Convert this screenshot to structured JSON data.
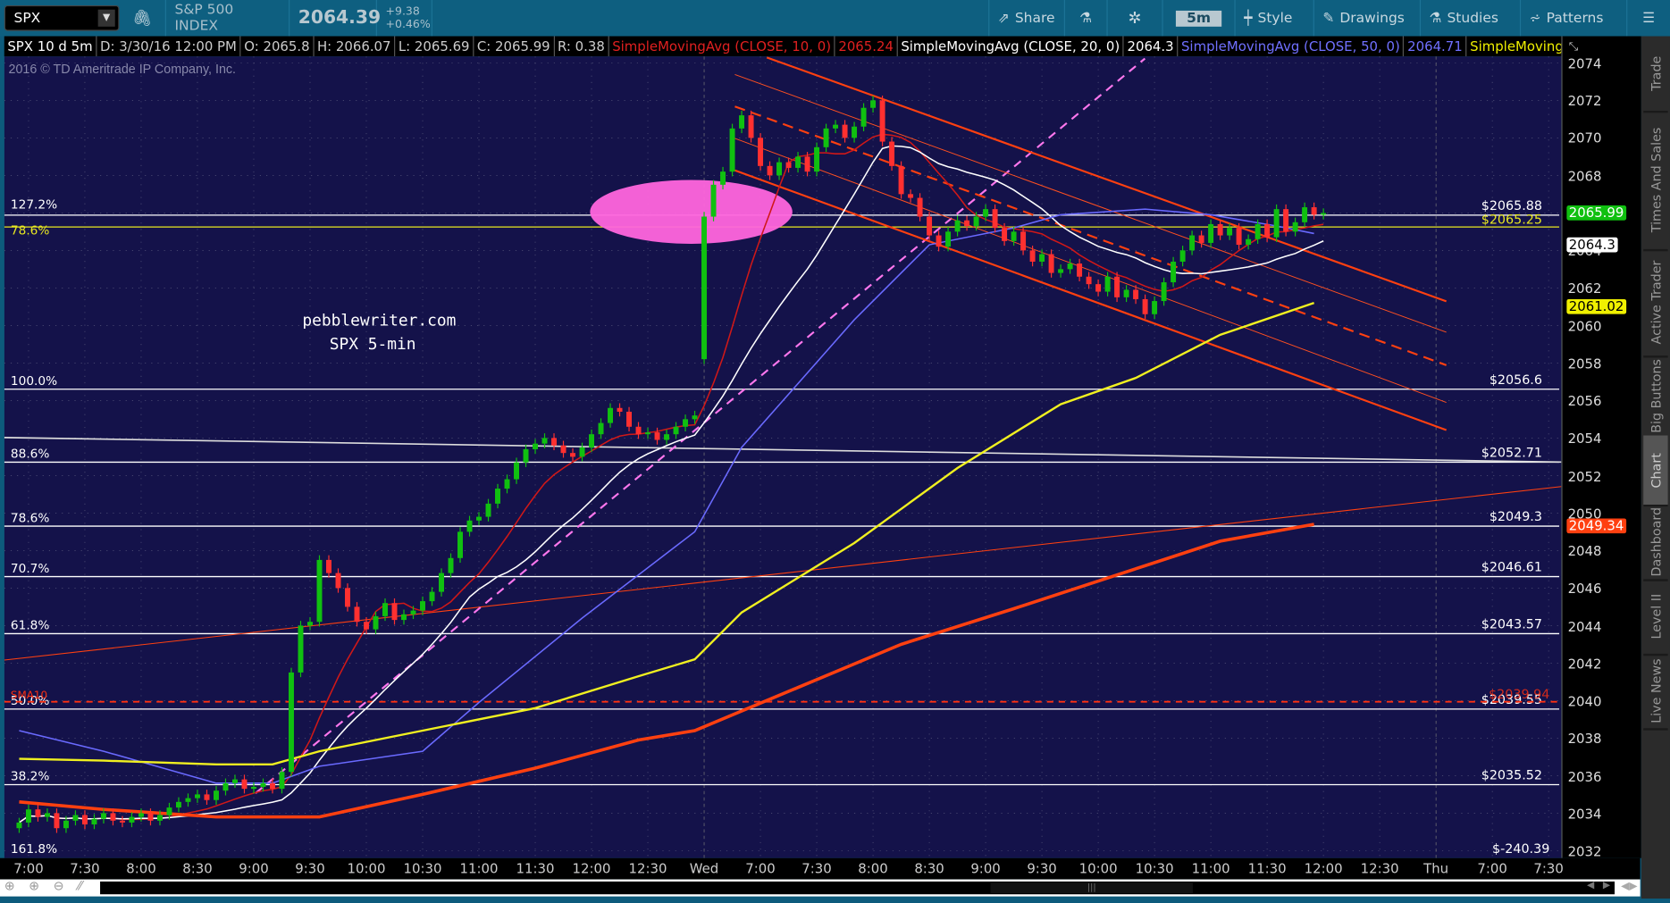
{
  "toolbar": {
    "symbol": "SPX",
    "description": "S&P 500 INDEX",
    "last": "2064.39",
    "change": "+9.38",
    "change_pct": "+0.46%",
    "share": "Share",
    "interval": "5m",
    "style": "Style",
    "drawings": "Drawings",
    "studies": "Studies",
    "patterns": "Patterns"
  },
  "info": {
    "title": "SPX 10 d 5m",
    "date": "D: 3/30/16 12:00 PM",
    "open": "O: 2065.8",
    "high": "H: 2066.07",
    "low": "L: 2065.69",
    "close": "C: 2065.99",
    "range": "R: 0.38",
    "studies": [
      {
        "name": "SimpleMovingAvg (CLOSE, 10, 0)",
        "value": "2065.24",
        "color": "#e02020"
      },
      {
        "name": "SimpleMovingAvg (CLOSE, 20, 0)",
        "value": "2064.3",
        "color": "#ffffff"
      },
      {
        "name": "SimpleMovingAvg (CLOSE, 50, 0)",
        "value": "2064.71",
        "color": "#7070ff"
      },
      {
        "name": "SimpleMovingAvg ...",
        "value": "",
        "color": "#f0f000"
      }
    ]
  },
  "copyright": "2016 © TD Ameritrade IP Company, Inc.",
  "watermark": {
    "line1": "pebblewriter.com",
    "line2": "SPX 5-min"
  },
  "side_tabs": [
    "Trade",
    "Times And Sales",
    "Active Trader",
    "Big Buttons",
    "Chart",
    "Dashboard",
    "Level II",
    "Live News"
  ],
  "active_tab": "Chart",
  "chart_data": {
    "type": "candlestick",
    "ylim": [
      2032,
      2074
    ],
    "y_ticks": [
      2032,
      2034,
      2036,
      2038,
      2040,
      2042,
      2044,
      2046,
      2048,
      2050,
      2052,
      2054,
      2056,
      2058,
      2060,
      2062,
      2064,
      2066,
      2068,
      2070,
      2072,
      2074
    ],
    "x_ticks": [
      {
        "i": 1,
        "t": "7:00"
      },
      {
        "i": 7,
        "t": "7:30"
      },
      {
        "i": 13,
        "t": "8:00"
      },
      {
        "i": 19,
        "t": "8:30"
      },
      {
        "i": 25,
        "t": "9:00"
      },
      {
        "i": 31,
        "t": "9:30"
      },
      {
        "i": 37,
        "t": "10:00"
      },
      {
        "i": 43,
        "t": "10:30"
      },
      {
        "i": 49,
        "t": "11:00"
      },
      {
        "i": 55,
        "t": "11:30"
      },
      {
        "i": 61,
        "t": "12:00"
      },
      {
        "i": 67,
        "t": "12:30"
      },
      {
        "i": 73,
        "t": "Wed"
      },
      {
        "i": 79,
        "t": "7:00"
      },
      {
        "i": 85,
        "t": "7:30"
      },
      {
        "i": 91,
        "t": "8:00"
      },
      {
        "i": 97,
        "t": "8:30"
      },
      {
        "i": 103,
        "t": "9:00"
      },
      {
        "i": 109,
        "t": "9:30"
      },
      {
        "i": 115,
        "t": "10:00"
      },
      {
        "i": 121,
        "t": "10:30"
      },
      {
        "i": 127,
        "t": "11:00"
      },
      {
        "i": 133,
        "t": "11:30"
      },
      {
        "i": 139,
        "t": "12:00"
      },
      {
        "i": 145,
        "t": "12:30"
      },
      {
        "i": 151,
        "t": "Thu"
      },
      {
        "i": 157,
        "t": "7:00"
      },
      {
        "i": 163,
        "t": "7:30"
      }
    ],
    "sessions": [
      {
        "start": 0,
        "open": 2033.2
      },
      {
        "start": 73,
        "open": 2058.2
      }
    ],
    "closes": [
      2033.5,
      2034.2,
      2033.8,
      2034.0,
      2033.2,
      2033.6,
      2033.9,
      2033.4,
      2033.7,
      2034.0,
      2033.6,
      2033.5,
      2033.8,
      2034.0,
      2033.6,
      2033.9,
      2034.3,
      2034.6,
      2034.8,
      2035.0,
      2034.7,
      2035.2,
      2035.6,
      2035.8,
      2035.3,
      2035.4,
      2035.6,
      2035.3,
      2036.2,
      2041.5,
      2044.0,
      2044.2,
      2047.5,
      2046.8,
      2046.0,
      2045.0,
      2044.2,
      2043.8,
      2044.5,
      2045.2,
      2044.3,
      2044.6,
      2044.8,
      2045.3,
      2045.8,
      2046.8,
      2047.6,
      2049.0,
      2049.6,
      2049.8,
      2050.5,
      2051.3,
      2051.8,
      2052.7,
      2053.4,
      2053.7,
      2054.0,
      2053.6,
      2053.2,
      2053.0,
      2053.5,
      2054.2,
      2054.8,
      2055.6,
      2055.4,
      2054.6,
      2054.2,
      2054.3,
      2053.9,
      2054.2,
      2054.6,
      2055.0,
      2055.2,
      2065.8,
      2067.5,
      2068.2,
      2070.5,
      2071.2,
      2070.0,
      2068.5,
      2068.0,
      2068.7,
      2068.4,
      2069.0,
      2068.2,
      2069.5,
      2070.5,
      2070.7,
      2070.0,
      2070.6,
      2071.6,
      2072.0,
      2069.8,
      2068.5,
      2067.0,
      2066.8,
      2065.8,
      2064.8,
      2064.2,
      2065.0,
      2065.6,
      2065.3,
      2065.8,
      2066.2,
      2065.2,
      2064.5,
      2065.0,
      2064.0,
      2063.4,
      2063.8,
      2062.8,
      2063.0,
      2063.3,
      2062.6,
      2062.2,
      2061.8,
      2062.6,
      2061.5,
      2061.9,
      2061.4,
      2060.6,
      2061.3,
      2062.3,
      2063.4,
      2064.0,
      2064.8,
      2064.4,
      2065.4,
      2064.8,
      2065.2,
      2064.3,
      2064.6,
      2065.4,
      2064.7,
      2066.2,
      2065.0,
      2065.5,
      2066.3,
      2065.9,
      2065.99
    ],
    "series": [
      {
        "name": "SimpleMovingAvg (CLOSE, 10, 0)",
        "color": "#d01818",
        "period": 10
      },
      {
        "name": "SimpleMovingAvg (CLOSE, 20, 0)",
        "color": "#ffffff",
        "period": 20
      },
      {
        "name": "SimpleMovingAvg (CLOSE, 50, 0)",
        "color": "#6a6aff",
        "points": [
          [
            0,
            2038.4
          ],
          [
            9,
            2037.3
          ],
          [
            21,
            2035.6
          ],
          [
            27,
            2035.6
          ],
          [
            32,
            2036.5
          ],
          [
            43,
            2037.3
          ],
          [
            49,
            2039.9
          ],
          [
            60,
            2044.4
          ],
          [
            72,
            2049
          ],
          [
            77,
            2053.5
          ],
          [
            89,
            2060.3
          ],
          [
            97,
            2064.3
          ],
          [
            106,
            2065.2
          ],
          [
            111,
            2065.9
          ],
          [
            120,
            2066.2
          ],
          [
            127,
            2065.9
          ],
          [
            134,
            2065.3
          ],
          [
            138,
            2064.9
          ]
        ]
      },
      {
        "name": "SimpleMovingAvg (yellow)",
        "color": "#f0f020",
        "points": [
          [
            0,
            2036.9
          ],
          [
            9,
            2036.8
          ],
          [
            21,
            2036.6
          ],
          [
            27,
            2036.6
          ],
          [
            32,
            2037.3
          ],
          [
            43,
            2038.4
          ],
          [
            55,
            2039.6
          ],
          [
            66,
            2041.3
          ],
          [
            72,
            2042.2
          ],
          [
            77,
            2044.7
          ],
          [
            89,
            2048.4
          ],
          [
            100,
            2052.4
          ],
          [
            111,
            2055.8
          ],
          [
            119,
            2057.2
          ],
          [
            128,
            2059.5
          ],
          [
            138,
            2061.2
          ]
        ]
      },
      {
        "name": "SimpleMovingAvg (orange)",
        "color": "#ff4010",
        "points": [
          [
            0,
            2034.6
          ],
          [
            9,
            2034.2
          ],
          [
            21,
            2033.8
          ],
          [
            32,
            2033.8
          ],
          [
            43,
            2035
          ],
          [
            55,
            2036.4
          ],
          [
            66,
            2037.9
          ],
          [
            72,
            2038.4
          ],
          [
            83,
            2040.7
          ],
          [
            94,
            2043
          ],
          [
            106,
            2044.9
          ],
          [
            117,
            2046.7
          ],
          [
            128,
            2048.5
          ],
          [
            138,
            2049.4
          ]
        ]
      }
    ],
    "fib_levels": [
      {
        "pct": "127.2%",
        "price": 2065.88,
        "label": "$2065.88",
        "color": "#ffffff"
      },
      {
        "pct": "78.6%",
        "price": 2065.25,
        "label": "$2065.25",
        "color": "#e8e820"
      },
      {
        "pct": "100.0%",
        "price": 2056.6,
        "label": "$2056.6",
        "color": "#ffffff"
      },
      {
        "pct": "88.6%",
        "price": 2052.71,
        "label": "$2052.71",
        "color": "#ffffff"
      },
      {
        "pct": "78.6%",
        "price": 2049.3,
        "label": "$2049.3",
        "color": "#ffffff"
      },
      {
        "pct": "70.7%",
        "price": 2046.61,
        "label": "$2046.61",
        "color": "#ffffff"
      },
      {
        "pct": "61.8%",
        "price": 2043.57,
        "label": "$2043.57",
        "color": "#ffffff"
      },
      {
        "pct": "50.0%",
        "price": 2039.55,
        "label": "$2039.55",
        "color": "#ffffff"
      },
      {
        "pct": "38.2%",
        "price": 2035.52,
        "label": "$2035.52",
        "color": "#ffffff"
      }
    ],
    "fib_offscreen": {
      "pct": "161.8%",
      "label": "$-240.39"
    },
    "sma_line": {
      "label": "SMA10",
      "price": 2039.94,
      "value_label": "$2039.94",
      "color": "#ff3010"
    },
    "price_tags": [
      {
        "value": "2065.99",
        "price": 2065.99,
        "bg": "#10c010",
        "fg": "#ffffff"
      },
      {
        "value": "2064.3",
        "price": 2064.3,
        "bg": "#ffffff",
        "fg": "#000000"
      },
      {
        "value": "2061.02",
        "price": 2061.02,
        "bg": "#f0f000",
        "fg": "#000000"
      },
      {
        "value": "2049.34",
        "price": 2049.34,
        "bg": "#ff4010",
        "fg": "#ffffff"
      }
    ],
    "colors": {
      "up": "#10c010",
      "down": "#ff3030",
      "background": "#14124a"
    }
  }
}
